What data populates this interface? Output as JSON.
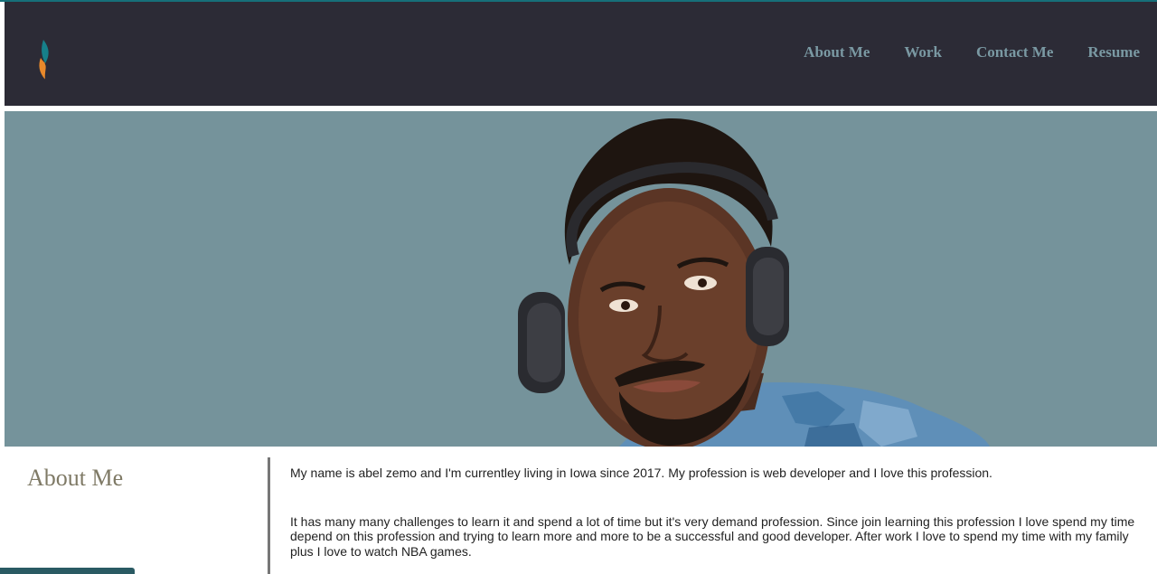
{
  "header": {
    "logo_icon": "flame-logo-icon",
    "nav": [
      {
        "label": "About Me"
      },
      {
        "label": "Work"
      },
      {
        "label": "Contact Me"
      },
      {
        "label": "Resume"
      }
    ]
  },
  "hero": {
    "image": "portrait-photo",
    "background_color": "#75939b"
  },
  "about": {
    "title": "About Me",
    "paragraphs": [
      "My name is abel zemo and I'm currentley living in Iowa since 2017. My profession is web developer and I love this profession.",
      "It has many many challenges to learn it and spend a lot of time but it's very demand profession. Since join learning this profession I love spend my time depend on this profession and trying to learn more and more to be a successful and good developer. After work I love to spend my time with my family plus I love to watch NBA games."
    ]
  },
  "colors": {
    "header_bg": "#2c2b36",
    "nav_text": "#7a99a3",
    "accent_teal": "#16707a",
    "accent_orange": "#e8892b",
    "title_text": "#7f7a66"
  }
}
